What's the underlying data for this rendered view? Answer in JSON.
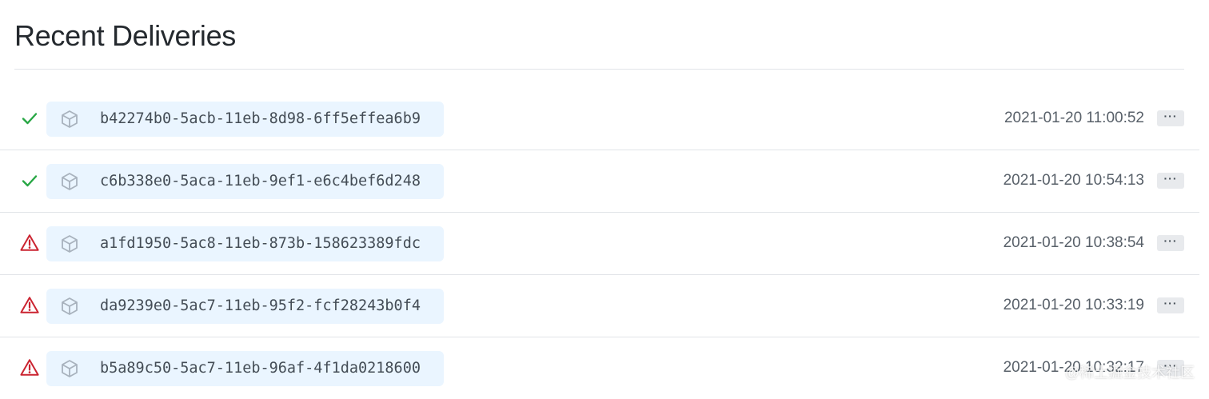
{
  "header": {
    "title": "Recent Deliveries"
  },
  "colors": {
    "success": "#28a745",
    "error": "#cb2431",
    "guid_background": "#eaf5ff",
    "box_icon": "#a8b2bd"
  },
  "deliveries": [
    {
      "status": "success",
      "status_icon": "check-icon",
      "guid": "b42274b0-5acb-11eb-8d98-6ff5effea6b9",
      "timestamp": "2021-01-20 11:00:52",
      "menu_label": "···"
    },
    {
      "status": "success",
      "status_icon": "check-icon",
      "guid": "c6b338e0-5aca-11eb-9ef1-e6c4bef6d248",
      "timestamp": "2021-01-20 10:54:13",
      "menu_label": "···"
    },
    {
      "status": "error",
      "status_icon": "alert-icon",
      "guid": "a1fd1950-5ac8-11eb-873b-158623389fdc",
      "timestamp": "2021-01-20 10:38:54",
      "menu_label": "···"
    },
    {
      "status": "error",
      "status_icon": "alert-icon",
      "guid": "da9239e0-5ac7-11eb-95f2-fcf28243b0f4",
      "timestamp": "2021-01-20 10:33:19",
      "menu_label": "···"
    },
    {
      "status": "error",
      "status_icon": "alert-icon",
      "guid": "b5a89c50-5ac7-11eb-96af-4f1da0218600",
      "timestamp": "2021-01-20 10:32:17",
      "menu_label": "···"
    }
  ],
  "watermark": "@稀土掘金技术社区"
}
